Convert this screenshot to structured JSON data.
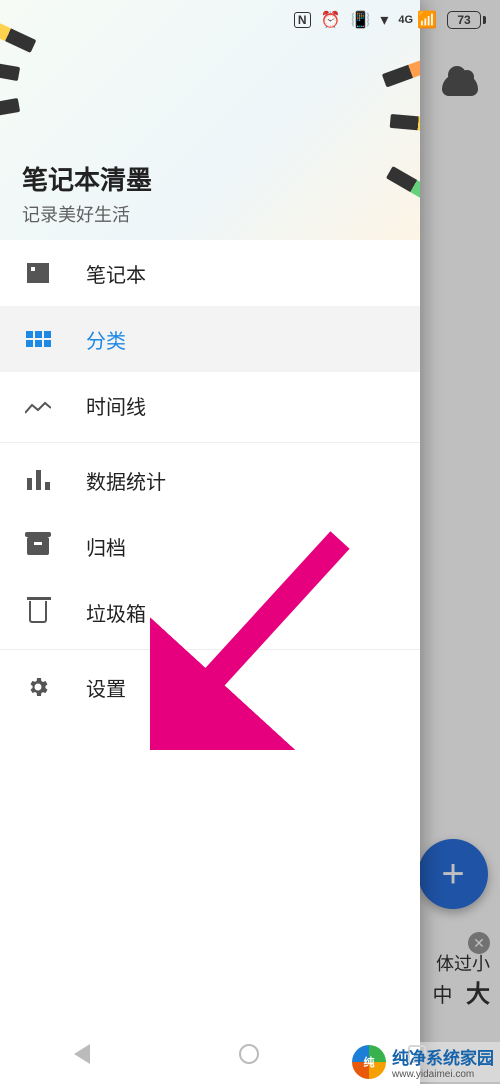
{
  "statusbar": {
    "nfc": "N",
    "network": "4G",
    "battery": "73"
  },
  "drawer": {
    "title": "笔记本清墨",
    "subtitle": "记录美好生活",
    "items": [
      {
        "label": "笔记本",
        "icon": "notebook-icon",
        "selected": false
      },
      {
        "label": "分类",
        "icon": "category-grid-icon",
        "selected": true
      },
      {
        "label": "时间线",
        "icon": "timeline-icon",
        "selected": false
      },
      {
        "label": "数据统计",
        "icon": "stats-icon",
        "selected": false
      },
      {
        "label": "归档",
        "icon": "archive-icon",
        "selected": false
      },
      {
        "label": "垃圾箱",
        "icon": "trash-icon",
        "selected": false
      },
      {
        "label": "设置",
        "icon": "settings-gear-icon",
        "selected": false
      }
    ]
  },
  "fab_label": "+",
  "partial_text": "体过小",
  "text_size_mid": "中",
  "text_size_large": "大",
  "annotation": {
    "arrow_color": "#e6007e",
    "points_to": "设置"
  },
  "watermark": {
    "brand": "纯净系统家园",
    "url": "www.yidaimei.com"
  }
}
